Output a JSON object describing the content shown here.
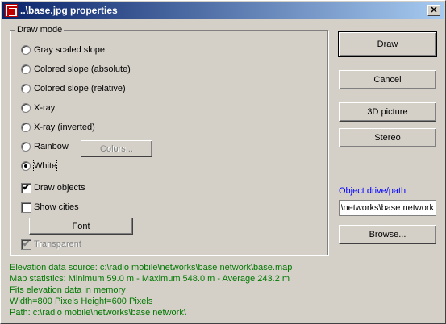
{
  "window": {
    "title": "..\\base.jpg properties",
    "close_label": "✕"
  },
  "draw_mode": {
    "legend": "Draw mode",
    "options": [
      {
        "label": "Gray scaled slope",
        "checked": false
      },
      {
        "label": "Colored slope (absolute)",
        "checked": false
      },
      {
        "label": "Colored slope (relative)",
        "checked": false
      },
      {
        "label": "X-ray",
        "checked": false
      },
      {
        "label": "X-ray (inverted)",
        "checked": false
      },
      {
        "label": "Rainbow",
        "checked": false
      },
      {
        "label": "White",
        "checked": true
      }
    ],
    "colors_button": "Colors...",
    "draw_objects": {
      "label": "Draw objects",
      "checked": true
    },
    "show_cities": {
      "label": "Show cities",
      "checked": false
    },
    "font_button": "Font",
    "transparent": {
      "label": "Transparent",
      "checked": true,
      "disabled": true
    }
  },
  "buttons": {
    "draw": "Draw",
    "cancel": "Cancel",
    "picture3d": "3D picture",
    "stereo": "Stereo",
    "browse": "Browse..."
  },
  "object_drive": {
    "label": "Object drive/path",
    "value": "c:\\radio mobile\\networks\\base network\\"
  },
  "info": {
    "line1": "Elevation data source: c:\\radio mobile\\networks\\base network\\base.map",
    "line2": "Map statistics: Minimum 59.0 m - Maximum 548.0 m - Average 243.2 m",
    "line3": "Fits elevation data in memory",
    "line4": "Width=800 Pixels  Height=600 Pixels",
    "line5": "Path: c:\\radio mobile\\networks\\base network\\"
  },
  "colors": {
    "titlebar_start": "#0a246a",
    "titlebar_end": "#a6caf0",
    "info_text": "#007800",
    "label_blue": "#0000ff"
  },
  "icons": {
    "app": "app-map-icon",
    "close": "close-icon"
  }
}
